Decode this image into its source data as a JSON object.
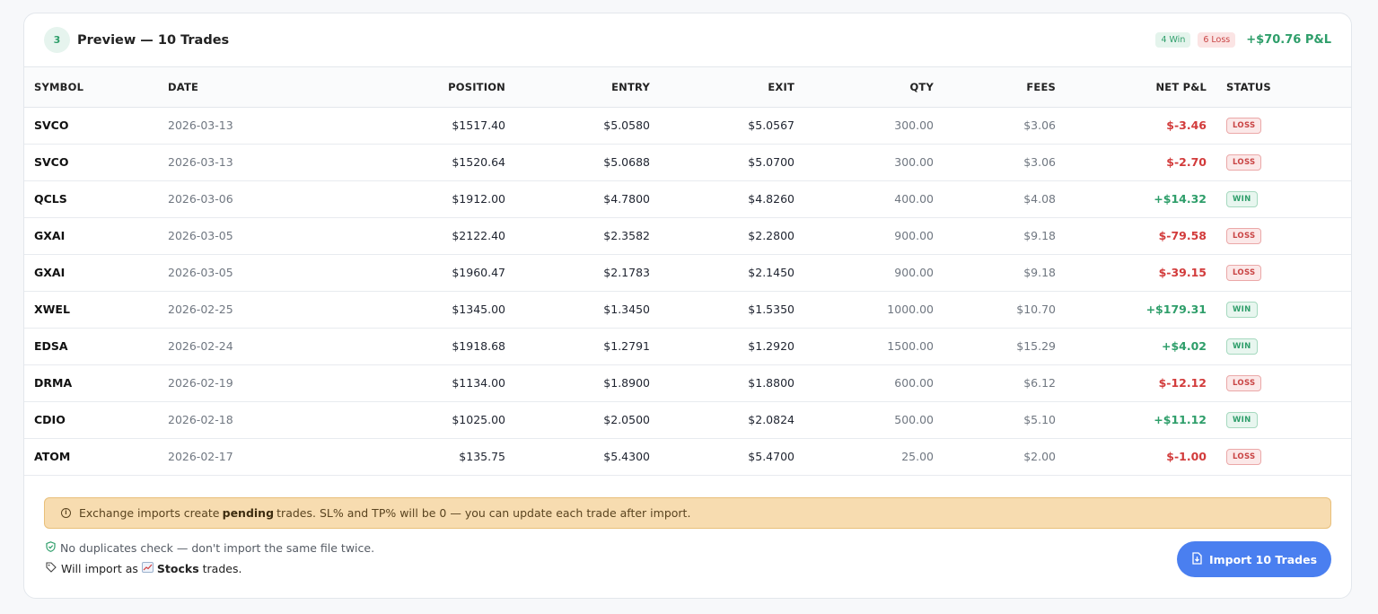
{
  "header": {
    "step": "3",
    "title": "Preview — 10 Trades",
    "win_pill": "4 Win",
    "loss_pill": "6 Loss",
    "total_pnl": "+$70.76 P&L"
  },
  "table": {
    "columns": [
      "SYMBOL",
      "DATE",
      "POSITION",
      "ENTRY",
      "EXIT",
      "QTY",
      "FEES",
      "NET P&L",
      "STATUS"
    ],
    "rows": [
      {
        "symbol": "SVCO",
        "date": "2026-03-13",
        "position": "$1517.40",
        "entry": "$5.0580",
        "exit": "$5.0567",
        "qty": "300.00",
        "fees": "$3.06",
        "pnl": "$-3.46",
        "status": "LOSS"
      },
      {
        "symbol": "SVCO",
        "date": "2026-03-13",
        "position": "$1520.64",
        "entry": "$5.0688",
        "exit": "$5.0700",
        "qty": "300.00",
        "fees": "$3.06",
        "pnl": "$-2.70",
        "status": "LOSS"
      },
      {
        "symbol": "QCLS",
        "date": "2026-03-06",
        "position": "$1912.00",
        "entry": "$4.7800",
        "exit": "$4.8260",
        "qty": "400.00",
        "fees": "$4.08",
        "pnl": "+$14.32",
        "status": "WIN"
      },
      {
        "symbol": "GXAI",
        "date": "2026-03-05",
        "position": "$2122.40",
        "entry": "$2.3582",
        "exit": "$2.2800",
        "qty": "900.00",
        "fees": "$9.18",
        "pnl": "$-79.58",
        "status": "LOSS"
      },
      {
        "symbol": "GXAI",
        "date": "2026-03-05",
        "position": "$1960.47",
        "entry": "$2.1783",
        "exit": "$2.1450",
        "qty": "900.00",
        "fees": "$9.18",
        "pnl": "$-39.15",
        "status": "LOSS"
      },
      {
        "symbol": "XWEL",
        "date": "2026-02-25",
        "position": "$1345.00",
        "entry": "$1.3450",
        "exit": "$1.5350",
        "qty": "1000.00",
        "fees": "$10.70",
        "pnl": "+$179.31",
        "status": "WIN"
      },
      {
        "symbol": "EDSA",
        "date": "2026-02-24",
        "position": "$1918.68",
        "entry": "$1.2791",
        "exit": "$1.2920",
        "qty": "1500.00",
        "fees": "$15.29",
        "pnl": "+$4.02",
        "status": "WIN"
      },
      {
        "symbol": "DRMA",
        "date": "2026-02-19",
        "position": "$1134.00",
        "entry": "$1.8900",
        "exit": "$1.8800",
        "qty": "600.00",
        "fees": "$6.12",
        "pnl": "$-12.12",
        "status": "LOSS"
      },
      {
        "symbol": "CDIO",
        "date": "2026-02-18",
        "position": "$1025.00",
        "entry": "$2.0500",
        "exit": "$2.0824",
        "qty": "500.00",
        "fees": "$5.10",
        "pnl": "+$11.12",
        "status": "WIN"
      },
      {
        "symbol": "ATOM",
        "date": "2026-02-17",
        "position": "$135.75",
        "entry": "$5.4300",
        "exit": "$5.4700",
        "qty": "25.00",
        "fees": "$2.00",
        "pnl": "$-1.00",
        "status": "LOSS"
      }
    ]
  },
  "notice": {
    "before": "Exchange imports create ",
    "bold": "pending",
    "after": " trades. SL% and TP% will be 0 — you can update each trade after import."
  },
  "footer": {
    "duplicates": "No duplicates check — don't import the same file twice.",
    "import_as_prefix": "Will import as",
    "import_as_type": "Stocks",
    "import_as_suffix": "trades."
  },
  "button": {
    "label": "Import 10 Trades"
  },
  "icons": {
    "info": "info-icon",
    "shield": "shield-check-icon",
    "tag": "tag-icon",
    "chart": "chart-up-icon",
    "file": "file-import-icon"
  },
  "colors": {
    "win": "#2e9e6a",
    "loss": "#d23b3b",
    "accent": "#4a7ff0",
    "notice_bg": "#f7dcb0"
  }
}
